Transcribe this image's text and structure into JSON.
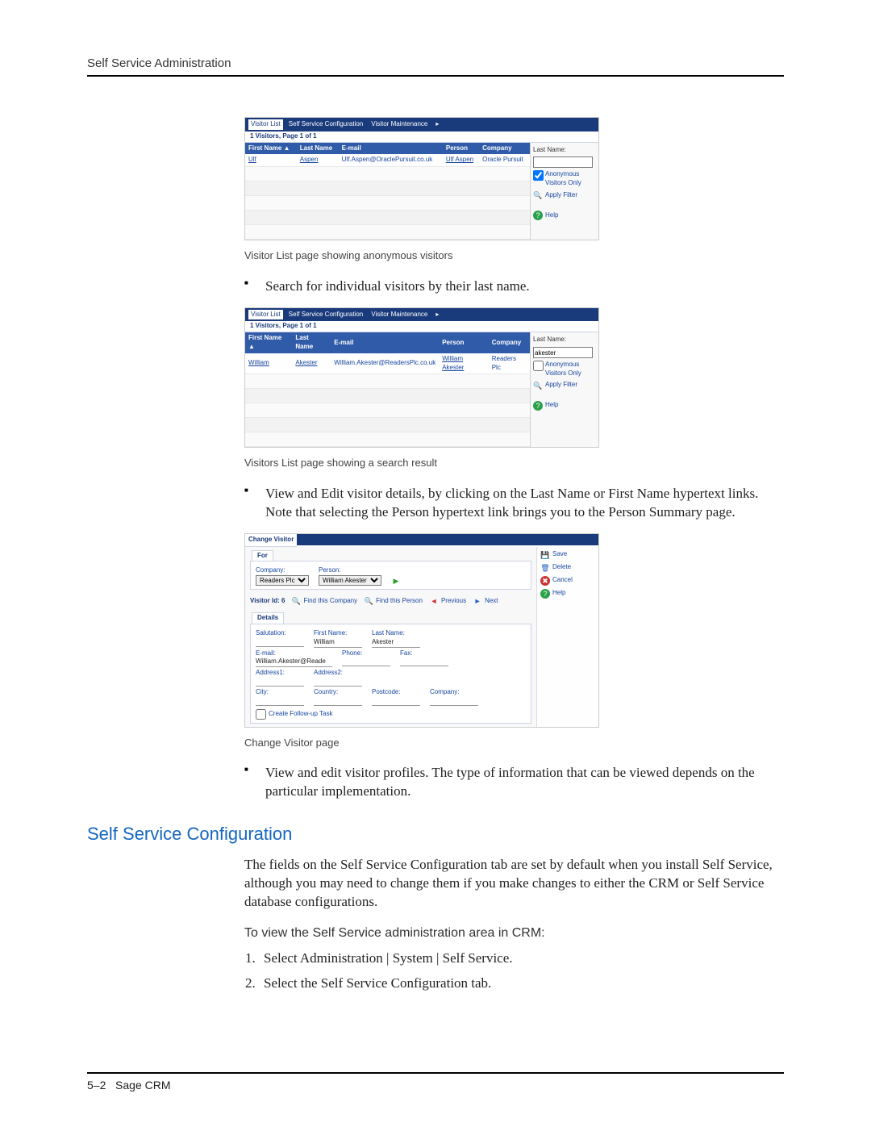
{
  "header": {
    "title": "Self Service Administration"
  },
  "footer": {
    "page_label": "5–2",
    "product": "Sage CRM"
  },
  "tabs": {
    "visitor_list": "Visitor List",
    "self_service_config": "Self Service Configuration",
    "visitor_maintenance": "Visitor Maintenance",
    "more": "▸"
  },
  "shot1": {
    "pager": "1 Visitors, Page 1 of 1",
    "columns": {
      "first_name": "First Name ▲",
      "last_name": "Last Name",
      "email": "E-mail",
      "person": "Person",
      "company": "Company"
    },
    "row": {
      "first_name": "Ulf",
      "last_name": "Aspen",
      "email": "Ulf.Aspen@OraclePursuit.co.uk",
      "person": "Ulf Aspen",
      "company": "Oracle Pursuit"
    },
    "side": {
      "last_name_label": "Last Name:",
      "last_name_value": "",
      "anon_label": "Anonymous Visitors Only",
      "apply_filter": "Apply Filter",
      "help": "Help"
    },
    "caption": "Visitor List page showing anonymous visitors"
  },
  "bullet1": "Search for individual visitors by their last name.",
  "shot2": {
    "pager": "1 Visitors, Page 1 of 1",
    "columns": {
      "first_name": "First Name ▲",
      "last_name": "Last Name",
      "email": "E-mail",
      "person": "Person",
      "company": "Company"
    },
    "row": {
      "first_name": "William",
      "last_name": "Akester",
      "email": "William.Akester@ReadersPlc.co.uk",
      "person": "William Akester",
      "company": "Readers Plc"
    },
    "side": {
      "last_name_label": "Last Name:",
      "last_name_value": "akester",
      "anon_label": "Anonymous Visitors Only",
      "apply_filter": "Apply Filter",
      "help": "Help"
    },
    "caption": "Visitors List page showing a search result"
  },
  "bullet2": "View and Edit visitor details, by clicking on the Last Name or First Name hypertext links. Note that selecting the Person hypertext link brings you to the Person Summary page.",
  "cv": {
    "title": "Change Visitor",
    "for_tab": "For",
    "company_label": "Company:",
    "company_value": "Readers Plc",
    "person_label": "Person:",
    "person_value": "William Akester",
    "visitor_id_label": "Visitor Id:",
    "visitor_id_value": "6",
    "find_company": "Find this Company",
    "find_person": "Find this Person",
    "prev": "Previous",
    "next": "Next",
    "details_tab": "Details",
    "fields": {
      "salutation_label": "Salutation:",
      "salutation_value": "",
      "first_name_label": "First Name:",
      "first_name_value": "William",
      "last_name_label": "Last Name:",
      "last_name_value": "Akester",
      "email_label": "E-mail:",
      "email_value": "William.Akester@Reade",
      "phone_label": "Phone:",
      "phone_value": "",
      "fax_label": "Fax:",
      "fax_value": "",
      "address1_label": "Address1:",
      "address2_label": "Address2:",
      "city_label": "City:",
      "country_label": "Country:",
      "postcode_label": "Postcode:",
      "company_label2": "Company:"
    },
    "followup": "Create Follow-up Task",
    "actions": {
      "save": "Save",
      "delete": "Delete",
      "cancel": "Cancel",
      "help": "Help"
    },
    "caption": "Change Visitor page"
  },
  "bullet3": "View and edit visitor profiles. The type of information that can be viewed depends on the particular implementation.",
  "section2": {
    "heading": "Self Service Configuration",
    "para": "The fields on the Self Service Configuration tab are set by default when you install Self Service, although you may need to change them if you make changes to either the CRM or Self Service database configurations.",
    "subhead": "To view the Self Service administration area in CRM:",
    "step1": "Select Administration | System | Self Service.",
    "step2": "Select the Self Service Configuration tab."
  }
}
